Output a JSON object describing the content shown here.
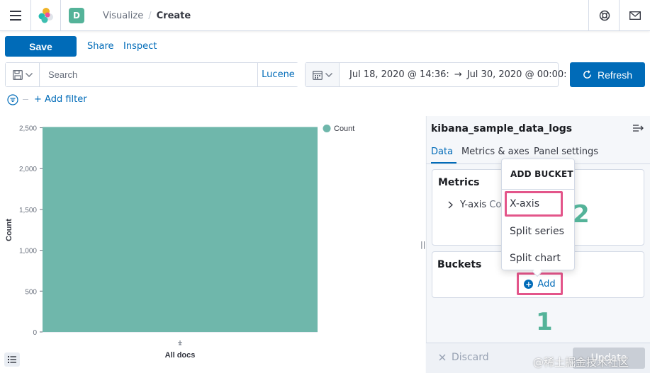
{
  "header": {
    "space_initial": "D",
    "breadcrumbs": [
      "Visualize",
      "Create"
    ]
  },
  "top_nav": {
    "save_label": "Save",
    "share_label": "Share",
    "inspect_label": "Inspect"
  },
  "query": {
    "placeholder": "Search",
    "language": "Lucene"
  },
  "date": {
    "start": "Jul 18, 2020 @ 14:36:",
    "arrow": "→",
    "end": "Jul 30, 2020 @ 00:00:"
  },
  "refresh_label": "Refresh",
  "add_filter_label": "+ Add filter",
  "chart_data": {
    "type": "bar",
    "categories": [
      "All docs"
    ],
    "series": [
      {
        "name": "Count",
        "values": [
          2510
        ]
      }
    ],
    "xlabel": "All docs",
    "ylabel": "Count",
    "ylim": [
      0,
      2600
    ],
    "yticks": [
      0,
      500,
      1000,
      1500,
      2000,
      2500
    ],
    "ytick_labels": [
      "0",
      "500",
      "1,000",
      "1,500",
      "2,000",
      "2,500"
    ],
    "legend_position": "top-right",
    "color": "#6fb7ab"
  },
  "sidebar": {
    "index_pattern": "kibana_sample_data_logs",
    "tabs": [
      "Data",
      "Metrics & axes",
      "Panel settings"
    ],
    "metrics_title": "Metrics",
    "metric_item": "Y-axis",
    "metric_item_rest": "Co",
    "buckets_title": "Buckets",
    "add_label": "Add"
  },
  "popover": {
    "title": "ADD BUCKET",
    "items": [
      "X-axis",
      "Split series",
      "Split chart"
    ]
  },
  "annotations": {
    "step1": "1",
    "step2": "2"
  },
  "footer": {
    "discard_label": "Discard",
    "update_label": "Update",
    "watermark": "@稀土掘金技术社区"
  },
  "colors": {
    "primary": "#006bb8",
    "accent": "#54b399",
    "highlight": "#e3558a"
  }
}
